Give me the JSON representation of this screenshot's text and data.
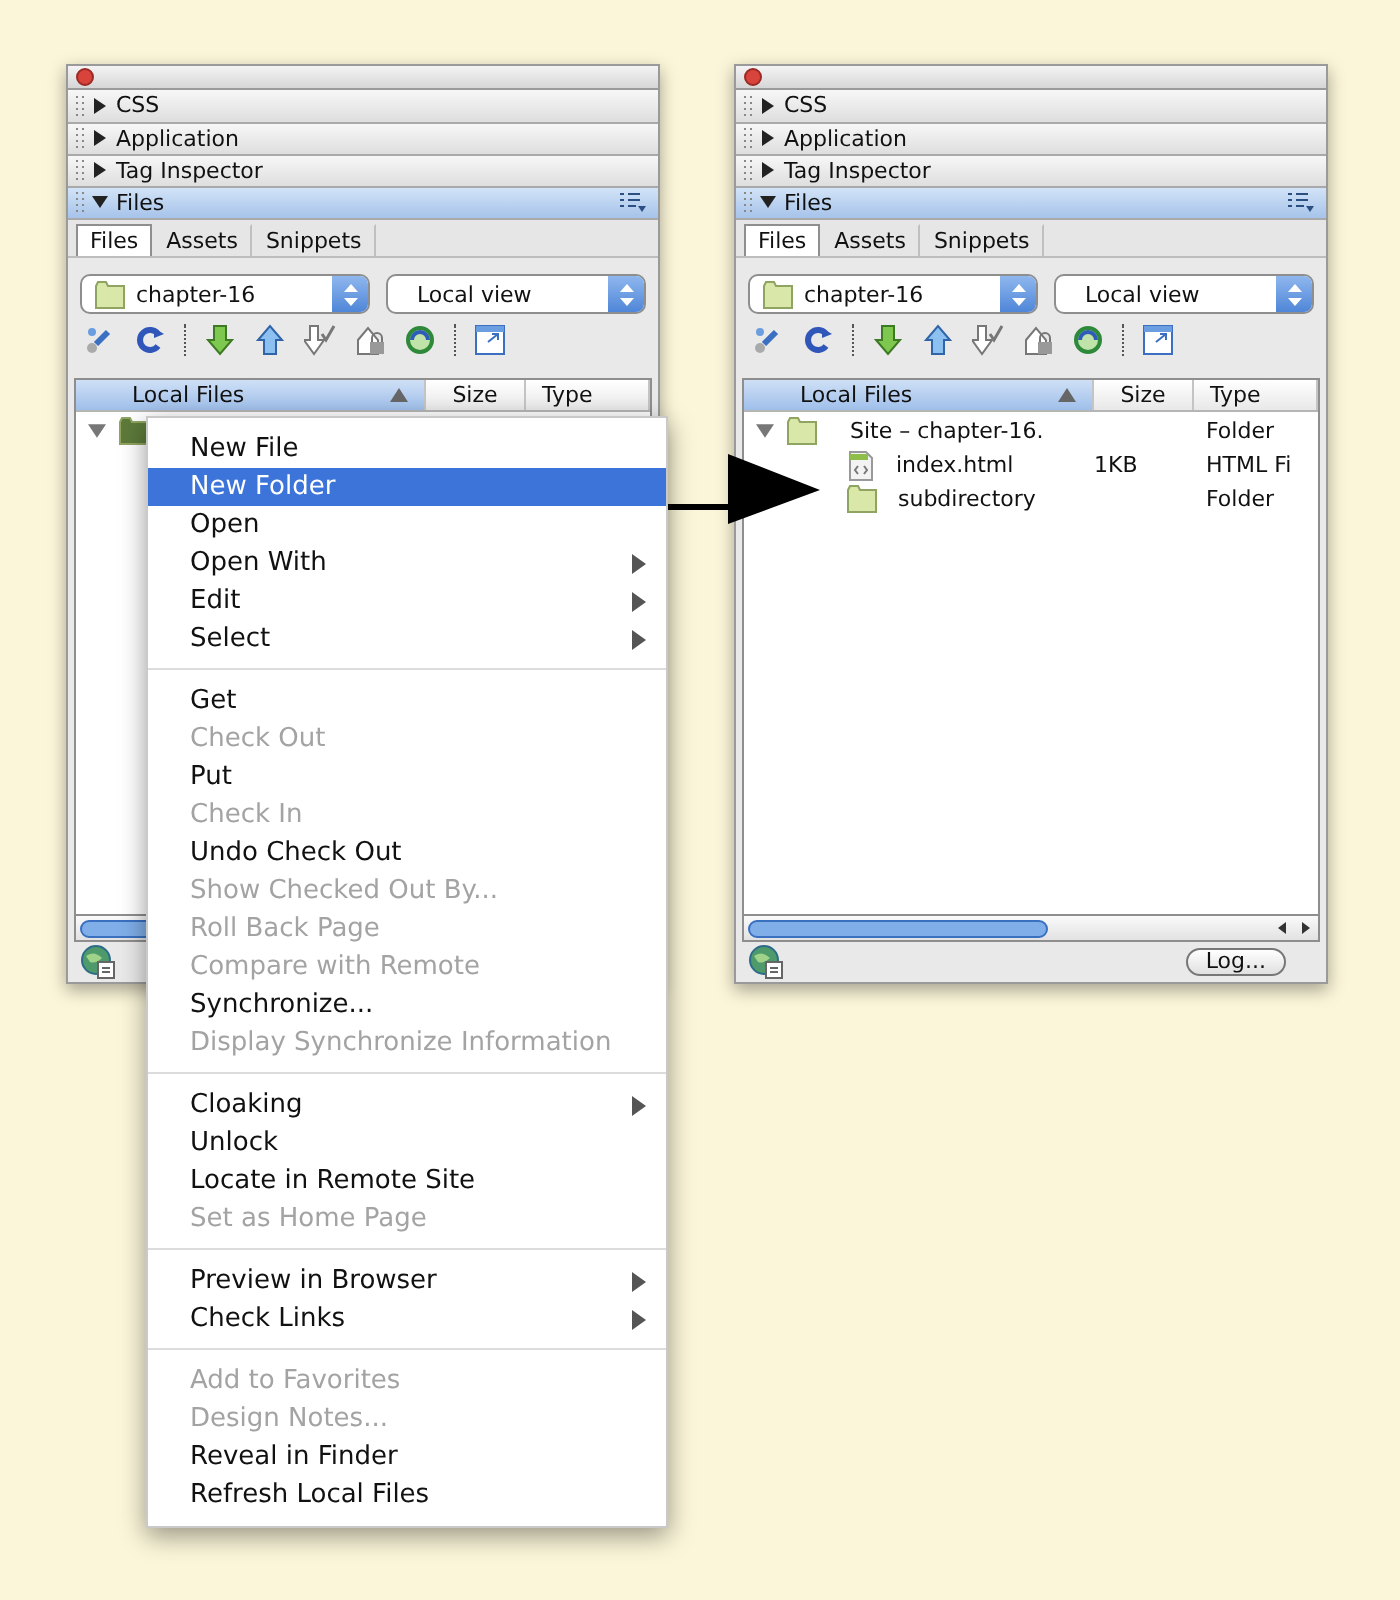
{
  "panels": [
    {
      "sections": [
        {
          "label": "CSS",
          "expanded": false
        },
        {
          "label": "Application",
          "expanded": false
        },
        {
          "label": "Tag Inspector",
          "expanded": false
        },
        {
          "label": "Files",
          "expanded": true
        }
      ],
      "tabs": [
        {
          "label": "Files",
          "selected": true
        },
        {
          "label": "Assets",
          "selected": false
        },
        {
          "label": "Snippets",
          "selected": false
        }
      ],
      "site_select": {
        "value": "chapter-16"
      },
      "view_select": {
        "value": "Local view"
      },
      "columns": [
        "Local Files",
        "Size",
        "Type"
      ],
      "tree": [
        {
          "kind": "folder",
          "expanded": true
        }
      ]
    },
    {
      "sections": [
        {
          "label": "CSS",
          "expanded": false
        },
        {
          "label": "Application",
          "expanded": false
        },
        {
          "label": "Tag Inspector",
          "expanded": false
        },
        {
          "label": "Files",
          "expanded": true
        }
      ],
      "tabs": [
        {
          "label": "Files",
          "selected": true
        },
        {
          "label": "Assets",
          "selected": false
        },
        {
          "label": "Snippets",
          "selected": false
        }
      ],
      "site_select": {
        "value": "chapter-16"
      },
      "view_select": {
        "value": "Local view"
      },
      "columns": [
        "Local Files",
        "Size",
        "Type"
      ],
      "tree": [
        {
          "kind": "folder",
          "name": "Site – chapter-16.",
          "type": "Folder",
          "expanded": true,
          "children": [
            {
              "kind": "file",
              "name": "index.html",
              "size": "1KB",
              "type": "HTML Fi"
            },
            {
              "kind": "folder",
              "name": "subdirectory",
              "type": "Folder"
            }
          ]
        }
      ],
      "log_button": "Log..."
    }
  ],
  "context_menu": {
    "groups": [
      [
        {
          "label": "New File",
          "selected": false,
          "disabled": false,
          "submenu": false
        },
        {
          "label": "New Folder",
          "selected": true,
          "disabled": false,
          "submenu": false
        },
        {
          "label": "Open",
          "selected": false,
          "disabled": false,
          "submenu": false
        },
        {
          "label": "Open With",
          "selected": false,
          "disabled": false,
          "submenu": true
        },
        {
          "label": "Edit",
          "selected": false,
          "disabled": false,
          "submenu": true
        },
        {
          "label": "Select",
          "selected": false,
          "disabled": false,
          "submenu": true
        }
      ],
      [
        {
          "label": "Get",
          "selected": false,
          "disabled": false,
          "submenu": false
        },
        {
          "label": "Check Out",
          "selected": false,
          "disabled": true,
          "submenu": false
        },
        {
          "label": "Put",
          "selected": false,
          "disabled": false,
          "submenu": false
        },
        {
          "label": "Check In",
          "selected": false,
          "disabled": true,
          "submenu": false
        },
        {
          "label": "Undo Check Out",
          "selected": false,
          "disabled": false,
          "submenu": false
        },
        {
          "label": "Show Checked Out By...",
          "selected": false,
          "disabled": true,
          "submenu": false
        },
        {
          "label": "Roll Back Page",
          "selected": false,
          "disabled": true,
          "submenu": false
        },
        {
          "label": "Compare with Remote",
          "selected": false,
          "disabled": true,
          "submenu": false
        },
        {
          "label": "Synchronize...",
          "selected": false,
          "disabled": false,
          "submenu": false
        },
        {
          "label": "Display Synchronize Information",
          "selected": false,
          "disabled": true,
          "submenu": false
        }
      ],
      [
        {
          "label": "Cloaking",
          "selected": false,
          "disabled": false,
          "submenu": true
        },
        {
          "label": "Unlock",
          "selected": false,
          "disabled": false,
          "submenu": false
        },
        {
          "label": "Locate in Remote Site",
          "selected": false,
          "disabled": false,
          "submenu": false
        },
        {
          "label": "Set as Home Page",
          "selected": false,
          "disabled": true,
          "submenu": false
        }
      ],
      [
        {
          "label": "Preview in Browser",
          "selected": false,
          "disabled": false,
          "submenu": true
        },
        {
          "label": "Check Links",
          "selected": false,
          "disabled": false,
          "submenu": true
        }
      ],
      [
        {
          "label": "Add to Favorites",
          "selected": false,
          "disabled": true,
          "submenu": false
        },
        {
          "label": "Design Notes...",
          "selected": false,
          "disabled": true,
          "submenu": false
        },
        {
          "label": "Reveal in Finder",
          "selected": false,
          "disabled": false,
          "submenu": false
        },
        {
          "label": "Refresh Local Files",
          "selected": false,
          "disabled": false,
          "submenu": false
        }
      ]
    ]
  }
}
